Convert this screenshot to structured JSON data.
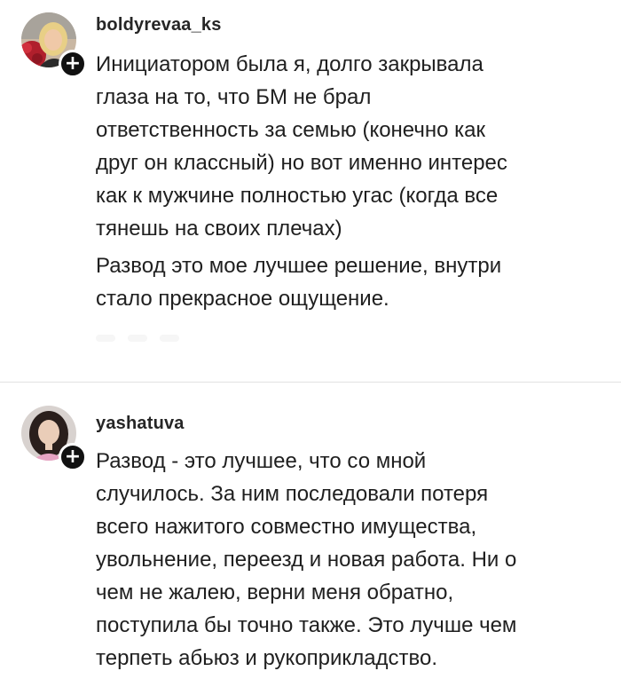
{
  "comments": [
    {
      "username": "boldyrevaa_ks",
      "follow_symbol": "+",
      "avatar_icon": "user-avatar-blonde-woman",
      "lines": [
        "Инициатором была я, долго закрывала",
        "глаза на то, что БМ не брал",
        "ответственность за семью (конечно как",
        "друг он классный) но вот именно интерес",
        "как к мужчине полностью угас (когда все",
        "тянешь на своих плечах)"
      ],
      "lines2": [
        "Развод это мое  лучшее решение, внутри",
        "стало прекрасное ощущение."
      ]
    },
    {
      "username": "yashatuva",
      "follow_symbol": "+",
      "avatar_icon": "user-avatar-dark-haired-woman",
      "lines": [
        "Развод - это лучшее, что со мной",
        "случилось. За ним последовали потеря",
        "всего нажитого совместно имущества,",
        "увольнение, переезд и новая работа. Ни о",
        "чем не жалею, верни меня обратно,",
        "поступила бы точно также. Это лучше чем",
        "терпеть абьюз и рукоприкладство."
      ]
    }
  ],
  "colors": {
    "background": "#ffffff",
    "text": "#1f1f1f",
    "username": "#262626",
    "badge": "#111111",
    "divider": "#e2e2e2"
  }
}
